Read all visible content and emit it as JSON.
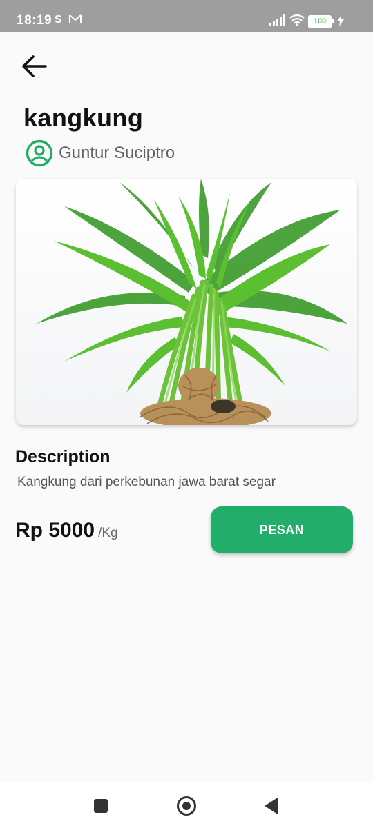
{
  "status_bar": {
    "time": "18:19",
    "s_indicator": "S",
    "battery_level": "100",
    "icons": [
      "gmail-icon",
      "signal-icon",
      "wifi-icon",
      "battery-icon",
      "charging-icon"
    ]
  },
  "product": {
    "name": "kangkung",
    "seller": "Guntur Suciptro",
    "description_heading": "Description",
    "description": "Kangkung dari perkebunan jawa barat segar",
    "price": "Rp 5000",
    "unit": "/Kg",
    "order_label": "PESAN"
  },
  "colors": {
    "accent": "#22ad6a",
    "status_bar": "#9e9e9e",
    "background": "#fafafa"
  }
}
